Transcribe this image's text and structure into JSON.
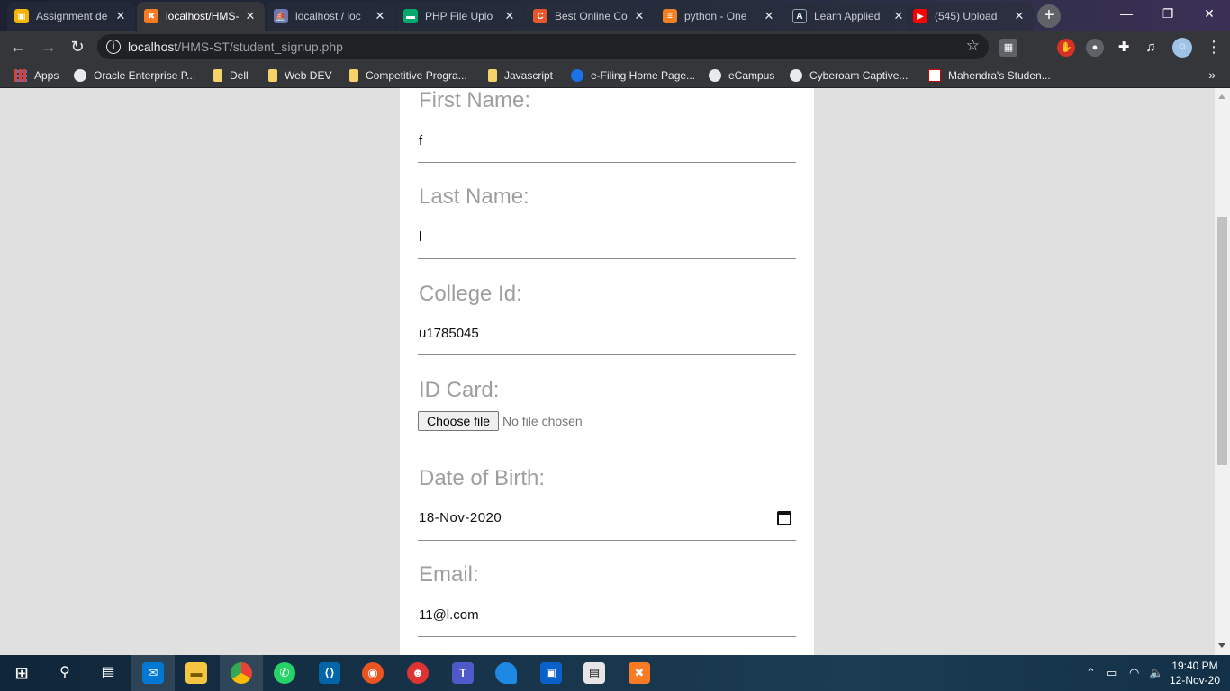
{
  "browser": {
    "tabs": [
      {
        "label": "Assignment de",
        "icon": "classroom-icon",
        "color": "#f4b400"
      },
      {
        "label": "localhost/HMS-",
        "icon": "xampp-icon",
        "color": "#fb7a24"
      },
      {
        "label": "localhost / loc",
        "icon": "phpmyadmin-icon",
        "color": "#6c78af"
      },
      {
        "label": "PHP File Uplo",
        "icon": "w3-icon",
        "color": "#04aa6d"
      },
      {
        "label": "Best Online Co",
        "icon": "site-icon",
        "color": "#e8572a"
      },
      {
        "label": "python - One",
        "icon": "stackoverflow-icon",
        "color": "#f48024"
      },
      {
        "label": "Learn Applied",
        "icon": "learn-icon",
        "color": "#1f2b3a"
      },
      {
        "label": "(545) Upload",
        "icon": "youtube-icon",
        "color": "#ff0000"
      }
    ],
    "url_host": "localhost",
    "url_path": "/HMS-ST/student_signup.php",
    "bookmarks": [
      {
        "label": "Apps",
        "type": "apps"
      },
      {
        "label": "Oracle Enterprise P...",
        "type": "globe"
      },
      {
        "label": "Dell",
        "type": "folder"
      },
      {
        "label": "Web DEV",
        "type": "folder"
      },
      {
        "label": "Competitive Progra...",
        "type": "folder"
      },
      {
        "label": "Javascript",
        "type": "folder"
      },
      {
        "label": "e-Filing Home Page...",
        "type": "globe"
      },
      {
        "label": "eCampus",
        "type": "globe"
      },
      {
        "label": "Cyberoam Captive...",
        "type": "globe"
      },
      {
        "label": "Mahendra's Studen...",
        "type": "site"
      }
    ]
  },
  "form": {
    "first_name_label": "First Name:",
    "first_name_value": "f",
    "last_name_label": "Last Name:",
    "last_name_value": "l",
    "college_id_label": "College Id:",
    "college_id_value": "u1785045",
    "id_card_label": "ID Card:",
    "choose_file_label": "Choose file",
    "no_file_text": "No file chosen",
    "dob_label": "Date of Birth:",
    "dob_value": "18-Nov-2020",
    "email_label": "Email:",
    "email_value": "11@l.com"
  },
  "taskbar": {
    "time": "19:40 PM",
    "date": "12-Nov-20"
  }
}
